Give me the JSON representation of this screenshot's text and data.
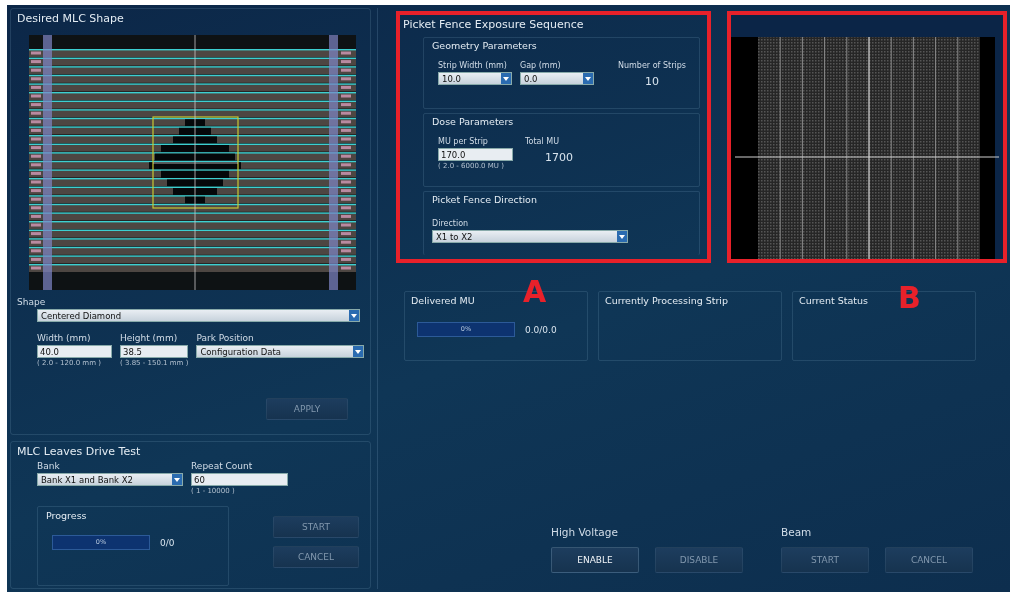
{
  "mlc_shape": {
    "title": "Desired MLC Shape",
    "shape": {
      "label": "Shape",
      "value": "Centered Diamond"
    },
    "width": {
      "label": "Width (mm)",
      "value": "40.0",
      "hint": "( 2.0 - 120.0 mm )"
    },
    "height": {
      "label": "Height (mm)",
      "value": "38.5",
      "hint": "( 3.85 - 150.1 mm )"
    },
    "park_position": {
      "label": "Park Position",
      "value": "Configuration Data"
    },
    "apply_button": {
      "label": "APPLY",
      "disabled": true
    }
  },
  "drive_test": {
    "title": "MLC Leaves Drive Test",
    "bank": {
      "label": "Bank",
      "value": "Bank X1 and Bank X2"
    },
    "repeat_count": {
      "label": "Repeat Count",
      "value": "60",
      "hint": "( 1 - 10000 )"
    },
    "progress": {
      "title": "Progress",
      "level": 0,
      "percent": "0%",
      "count": "0/0"
    },
    "buttons": [
      {
        "label": "START",
        "disabled": true
      },
      {
        "label": "CANCEL",
        "disabled": true
      }
    ]
  },
  "picket_fence": {
    "title": "Picket Fence Exposure Sequence",
    "highlighted": true,
    "geometry": {
      "title": "Geometry Parameters",
      "strip_width": {
        "label": "Strip Width (mm)",
        "value": "10.0"
      },
      "gap": {
        "label": "Gap (mm)",
        "value": "0.0"
      },
      "strips": {
        "label": "Number of Strips",
        "value": "10"
      }
    },
    "dose": {
      "title": "Dose Parameters",
      "mu_per_strip": {
        "label": "MU per Strip",
        "value": "170.0",
        "hint": "( 2.0 - 6000.0 MU )"
      },
      "total_mu": {
        "label": "Total MU",
        "value": "1700"
      }
    },
    "direction": {
      "title": "Picket Fence Direction",
      "label": "Direction",
      "value": "X1 to X2"
    }
  },
  "preview": {
    "highlighted": true
  },
  "annotations": [
    {
      "label": "A"
    },
    {
      "label": "B"
    }
  ],
  "delivered": {
    "title": "Delivered MU",
    "level": 0,
    "percent": "0%",
    "reading": "0.0/0.0"
  },
  "processing": {
    "title": "Currently Processing Strip"
  },
  "status": {
    "title": "Current Status"
  },
  "high_voltage": {
    "title": "High Voltage",
    "buttons": [
      {
        "label": "ENABLE",
        "disabled": false
      },
      {
        "label": "DISABLE",
        "disabled": true
      }
    ]
  },
  "beam": {
    "title": "Beam",
    "buttons": [
      {
        "label": "START",
        "disabled": true
      },
      {
        "label": "CANCEL",
        "disabled": true
      }
    ]
  }
}
